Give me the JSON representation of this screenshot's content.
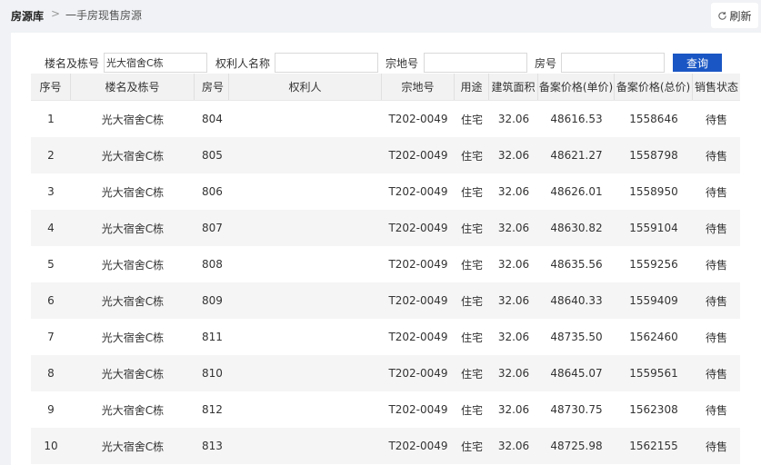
{
  "breadcrumb": {
    "root": "房源库",
    "separator": ">",
    "current": "一手房现售房源"
  },
  "toolbar": {
    "refresh_label": "刷新"
  },
  "filters": {
    "building_label": "楼名及栋号",
    "building_value": "光大宿舍C栋",
    "owner_label": "权利人名称",
    "owner_value": "",
    "parcel_label": "宗地号",
    "parcel_value": "",
    "room_label": "房号",
    "room_value": "",
    "search_label": "查询"
  },
  "table": {
    "headers": [
      "序号",
      "楼名及栋号",
      "房号",
      "权利人",
      "宗地号",
      "用途",
      "建筑面积",
      "备案价格(单价)",
      "备案价格(总价)",
      "销售状态"
    ],
    "rows": [
      [
        "1",
        "光大宿舍C栋",
        "804",
        "",
        "T202-0049",
        "住宅",
        "32.06",
        "48616.53",
        "1558646",
        "待售"
      ],
      [
        "2",
        "光大宿舍C栋",
        "805",
        "",
        "T202-0049",
        "住宅",
        "32.06",
        "48621.27",
        "1558798",
        "待售"
      ],
      [
        "3",
        "光大宿舍C栋",
        "806",
        "",
        "T202-0049",
        "住宅",
        "32.06",
        "48626.01",
        "1558950",
        "待售"
      ],
      [
        "4",
        "光大宿舍C栋",
        "807",
        "",
        "T202-0049",
        "住宅",
        "32.06",
        "48630.82",
        "1559104",
        "待售"
      ],
      [
        "5",
        "光大宿舍C栋",
        "808",
        "",
        "T202-0049",
        "住宅",
        "32.06",
        "48635.56",
        "1559256",
        "待售"
      ],
      [
        "6",
        "光大宿舍C栋",
        "809",
        "",
        "T202-0049",
        "住宅",
        "32.06",
        "48640.33",
        "1559409",
        "待售"
      ],
      [
        "7",
        "光大宿舍C栋",
        "811",
        "",
        "T202-0049",
        "住宅",
        "32.06",
        "48735.50",
        "1562460",
        "待售"
      ],
      [
        "8",
        "光大宿舍C栋",
        "810",
        "",
        "T202-0049",
        "住宅",
        "32.06",
        "48645.07",
        "1559561",
        "待售"
      ],
      [
        "9",
        "光大宿舍C栋",
        "812",
        "",
        "T202-0049",
        "住宅",
        "32.06",
        "48730.75",
        "1562308",
        "待售"
      ],
      [
        "10",
        "光大宿舍C栋",
        "813",
        "",
        "T202-0049",
        "住宅",
        "32.06",
        "48725.98",
        "1562155",
        "待售"
      ]
    ]
  },
  "colors": {
    "accent": "#1a56c4",
    "row_alt": "#f5f5f5",
    "header_bg": "#f2f2f2"
  }
}
